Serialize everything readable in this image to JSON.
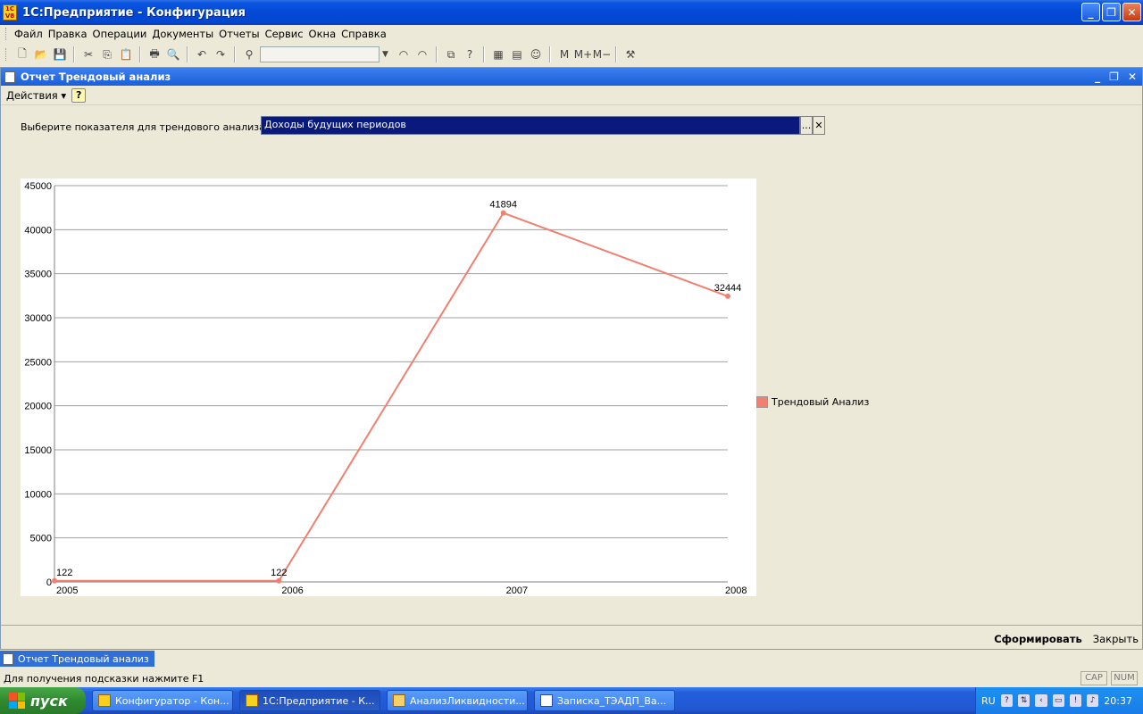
{
  "window": {
    "title": "1С:Предприятие - Конфигурация"
  },
  "menu": [
    "Файл",
    "Правка",
    "Операции",
    "Документы",
    "Отчеты",
    "Сервис",
    "Окна",
    "Справка"
  ],
  "report": {
    "title": "Отчет  Трендовый анализ",
    "actions_label": "Действия",
    "selector_label": "Выберите показателя для трендового анализа",
    "selector_value": "Доходы будущих периодов",
    "form_button": "Сформировать",
    "close_button": "Закрыть"
  },
  "chart_data": {
    "type": "line",
    "x": [
      "2005",
      "2006",
      "2007",
      "2008"
    ],
    "series": [
      {
        "name": "Трендовый Анализ",
        "values": [
          122,
          122,
          41894,
          32444
        ],
        "color": "#f08070"
      }
    ],
    "ylim": [
      0,
      45000
    ],
    "yticks": [
      0,
      5000,
      10000,
      15000,
      20000,
      25000,
      30000,
      35000,
      40000,
      45000
    ],
    "grid": true,
    "legend": "right"
  },
  "window_tab": "Отчет  Трендовый анализ",
  "status": {
    "hint": "Для получения подсказки нажмите F1",
    "cap": "CAP",
    "num": "NUM"
  },
  "taskbar": {
    "start": "пуск",
    "tasks": [
      "Конфигуратор - Кон...",
      "1С:Предприятие - К...",
      "АнализЛиквидности...",
      "Записка_ТЭАДП_Ва..."
    ],
    "lang": "RU",
    "time": "20:37"
  }
}
